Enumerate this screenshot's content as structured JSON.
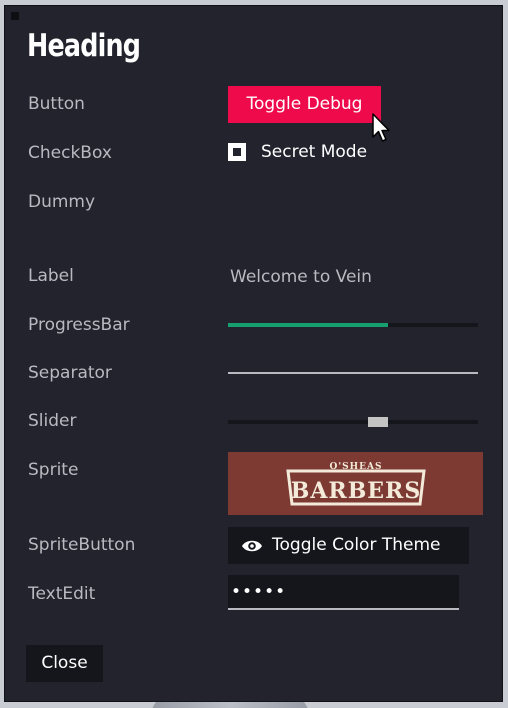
{
  "window": {
    "heading": "Heading"
  },
  "rows": {
    "button": {
      "label": "Button",
      "control_text": "Toggle Debug"
    },
    "checkbox": {
      "label": "CheckBox",
      "control_text": "Secret Mode",
      "checked": true
    },
    "dummy": {
      "label": "Dummy"
    },
    "label": {
      "label": "Label",
      "value": "Welcome to Vein"
    },
    "progressbar": {
      "label": "ProgressBar",
      "value_fraction": 0.64
    },
    "separator": {
      "label": "Separator"
    },
    "slider": {
      "label": "Slider",
      "value_fraction": 0.6
    },
    "sprite": {
      "label": "Sprite",
      "image_text_top": "O'SHEAS",
      "image_text_main": "BARBERS"
    },
    "spritebutton": {
      "label": "SpriteButton",
      "control_text": "Toggle Color Theme",
      "icon": "eye-icon"
    },
    "textedit": {
      "label": "TextEdit",
      "value": "•••••"
    }
  },
  "footer": {
    "close_label": "Close"
  },
  "colors": {
    "window_bg": "#22232d",
    "accent_button": "#ee0a4b",
    "progress_fill": "#16a070",
    "sprite_bg": "#7c3a33",
    "field_bg": "#15161c",
    "label_text": "#b8bac0"
  }
}
